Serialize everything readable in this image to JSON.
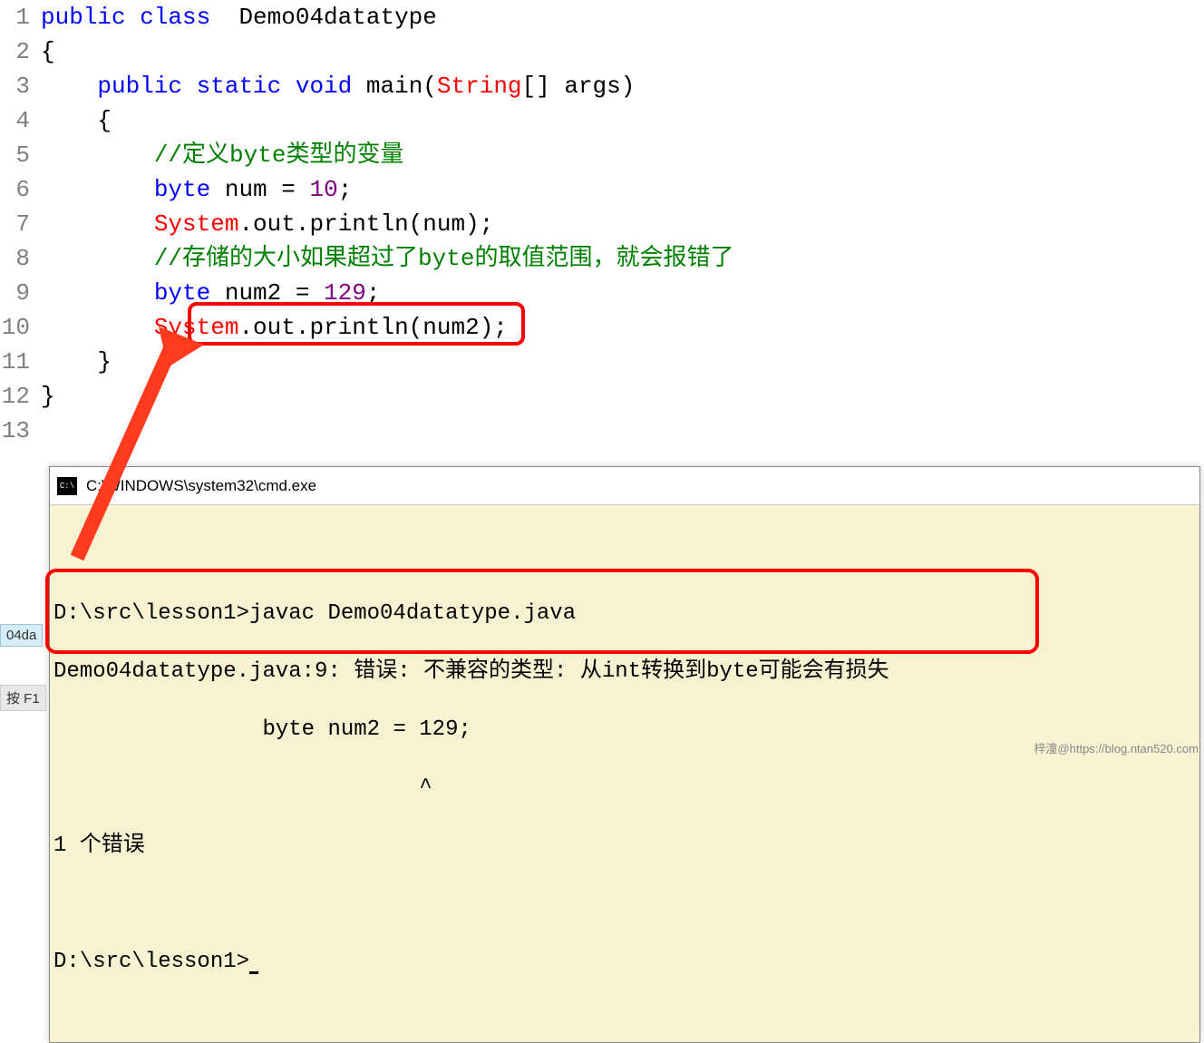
{
  "editor": {
    "lines": [
      {
        "num": "1",
        "segments": [
          {
            "cls": "kw-blue",
            "text": "public class"
          },
          {
            "cls": "kw-black",
            "text": "  Demo04datatype"
          }
        ]
      },
      {
        "num": "2",
        "segments": [
          {
            "cls": "kw-black",
            "text": "{"
          }
        ]
      },
      {
        "num": "3",
        "segments": [
          {
            "cls": "kw-black",
            "text": "    "
          },
          {
            "cls": "kw-blue",
            "text": "public static void"
          },
          {
            "cls": "kw-black",
            "text": " main("
          },
          {
            "cls": "kw-red",
            "text": "String"
          },
          {
            "cls": "kw-black",
            "text": "[] args)"
          }
        ]
      },
      {
        "num": "4",
        "segments": [
          {
            "cls": "kw-black",
            "text": "    {"
          }
        ]
      },
      {
        "num": "5",
        "segments": [
          {
            "cls": "kw-black",
            "text": "        "
          },
          {
            "cls": "kw-green",
            "text": "//定义byte类型的变量"
          }
        ]
      },
      {
        "num": "6",
        "segments": [
          {
            "cls": "kw-black",
            "text": "        "
          },
          {
            "cls": "kw-blue",
            "text": "byte"
          },
          {
            "cls": "kw-black",
            "text": " num = "
          },
          {
            "cls": "kw-purple",
            "text": "10"
          },
          {
            "cls": "kw-black",
            "text": ";"
          }
        ]
      },
      {
        "num": "7",
        "segments": [
          {
            "cls": "kw-black",
            "text": "        "
          },
          {
            "cls": "kw-red",
            "text": "System"
          },
          {
            "cls": "kw-black",
            "text": ".out.println(num);"
          }
        ]
      },
      {
        "num": "8",
        "segments": [
          {
            "cls": "kw-black",
            "text": "        "
          },
          {
            "cls": "kw-green",
            "text": "//存储的大小如果超过了byte的取值范围，就会报错了"
          }
        ]
      },
      {
        "num": "9",
        "segments": [
          {
            "cls": "kw-black",
            "text": "        "
          },
          {
            "cls": "kw-blue",
            "text": "byte"
          },
          {
            "cls": "kw-black",
            "text": " num2 = "
          },
          {
            "cls": "kw-purple",
            "text": "129"
          },
          {
            "cls": "kw-black",
            "text": ";"
          }
        ]
      },
      {
        "num": "10",
        "segments": [
          {
            "cls": "kw-black",
            "text": "        "
          },
          {
            "cls": "kw-red",
            "text": "System"
          },
          {
            "cls": "kw-black",
            "text": ".out.println(num2);"
          }
        ]
      },
      {
        "num": "11",
        "segments": [
          {
            "cls": "kw-black",
            "text": "    }"
          }
        ]
      },
      {
        "num": "12",
        "segments": [
          {
            "cls": "kw-black",
            "text": "}"
          }
        ]
      },
      {
        "num": "13",
        "segments": []
      }
    ]
  },
  "cmd": {
    "title": "C:\\WINDOWS\\system32\\cmd.exe",
    "blank_line": " ",
    "line1": "D:\\src\\lesson1>javac Demo04datatype.java",
    "line2": "Demo04datatype.java:9: 错误: 不兼容的类型: 从int转换到byte可能会有损失",
    "line3": "                byte num2 = 129;",
    "line4": "                            ^",
    "line5": "1 个错误",
    "line6": " ",
    "prompt": "D:\\src\\lesson1>"
  },
  "fragments": {
    "tab1": "04da",
    "tab2": "按 F1"
  },
  "watermark": "梓潼@https://blog.ntan520.com"
}
